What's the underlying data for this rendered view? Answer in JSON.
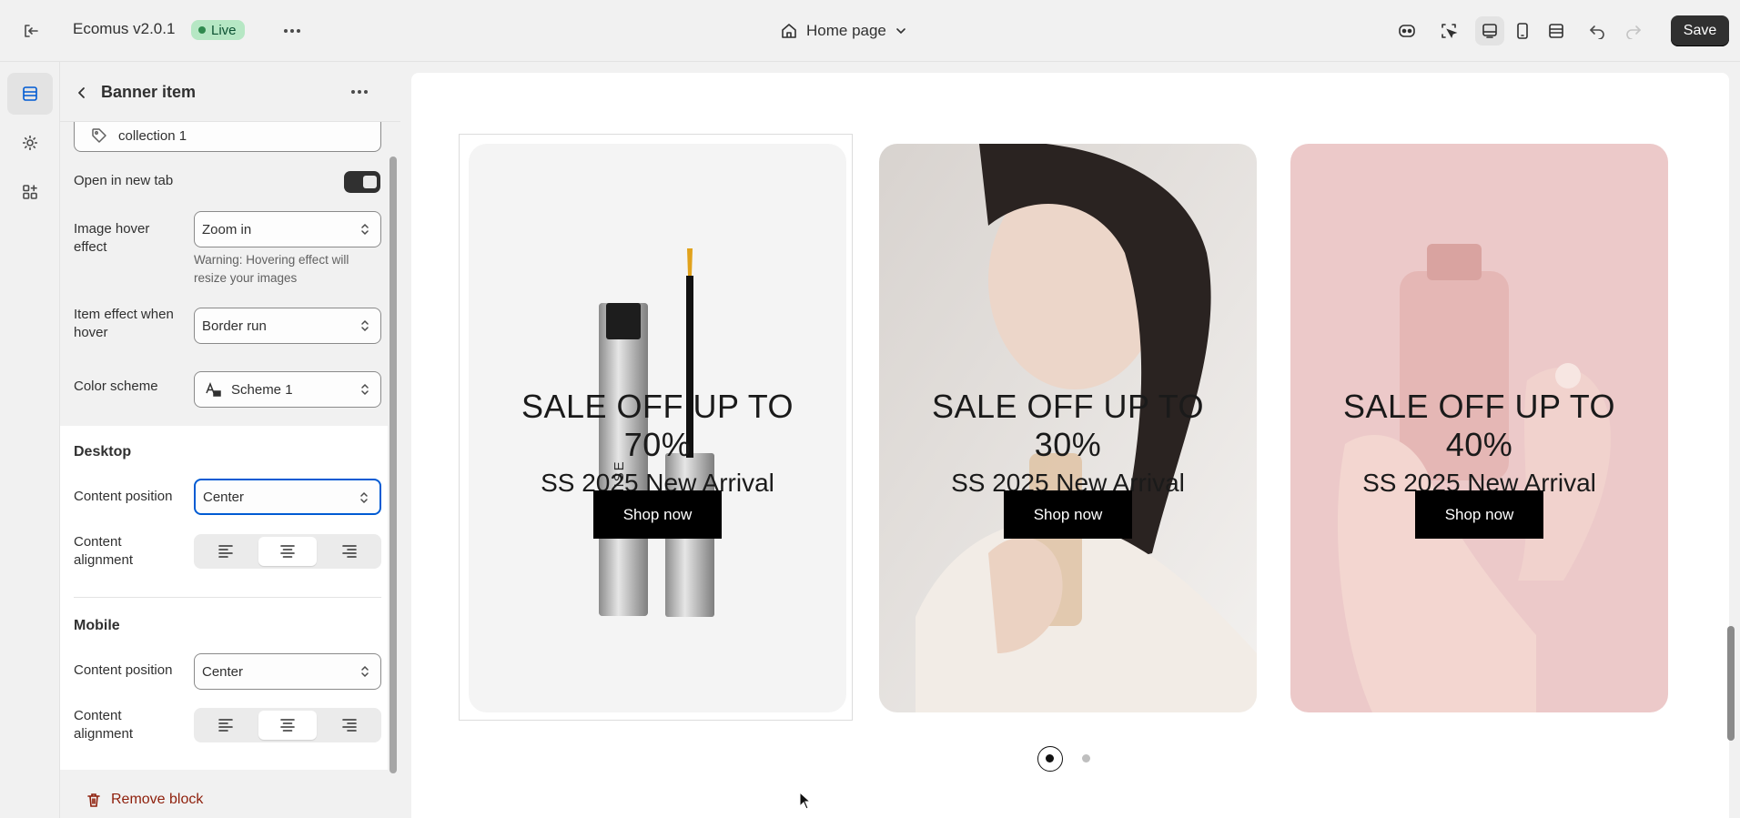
{
  "topbar": {
    "theme_name": "Ecomus v2.0.1",
    "status_badge": "Live",
    "page_selector": "Home page",
    "save_label": "Save"
  },
  "panel": {
    "title": "Banner item",
    "link_value": "collection 1",
    "open_new_tab_label": "Open in new tab",
    "open_new_tab_on": true,
    "image_hover_label": "Image hover effect",
    "image_hover_value": "Zoom in",
    "image_hover_help": "Warning: Hovering effect will resize your images",
    "item_effect_label": "Item effect when hover",
    "item_effect_value": "Border run",
    "color_scheme_label": "Color scheme",
    "color_scheme_value": "Scheme 1",
    "desktop": {
      "heading": "Desktop",
      "content_position_label": "Content position",
      "content_position_value": "Center",
      "content_alignment_label": "Content alignment",
      "alignment_selected": "center"
    },
    "mobile": {
      "heading": "Mobile",
      "content_position_label": "Content position",
      "content_position_value": "Center",
      "content_alignment_label": "Content alignment",
      "alignment_selected": "center"
    },
    "remove_block_label": "Remove block"
  },
  "banners": [
    {
      "title": "SALE OFF UP TO 70%",
      "subtitle": "SS 2025 New Arrival",
      "button": "Shop now",
      "bg": "#f4f4f4"
    },
    {
      "title": "SALE OFF UP TO 30%",
      "subtitle": "SS 2025 New Arrival",
      "button": "Shop now",
      "bg": "#e7e1dc"
    },
    {
      "title": "SALE OFF UP TO 40%",
      "subtitle": "SS 2025 New Arrival",
      "button": "Shop now",
      "bg": "#ecc9c9"
    }
  ],
  "carousel": {
    "active_page": 1,
    "total_pages": 2
  },
  "colors": {
    "accent_focus": "#005bd3",
    "live_badge_bg": "#b6e7c4",
    "save_bg": "#303030",
    "danger": "#8e1f0b"
  }
}
